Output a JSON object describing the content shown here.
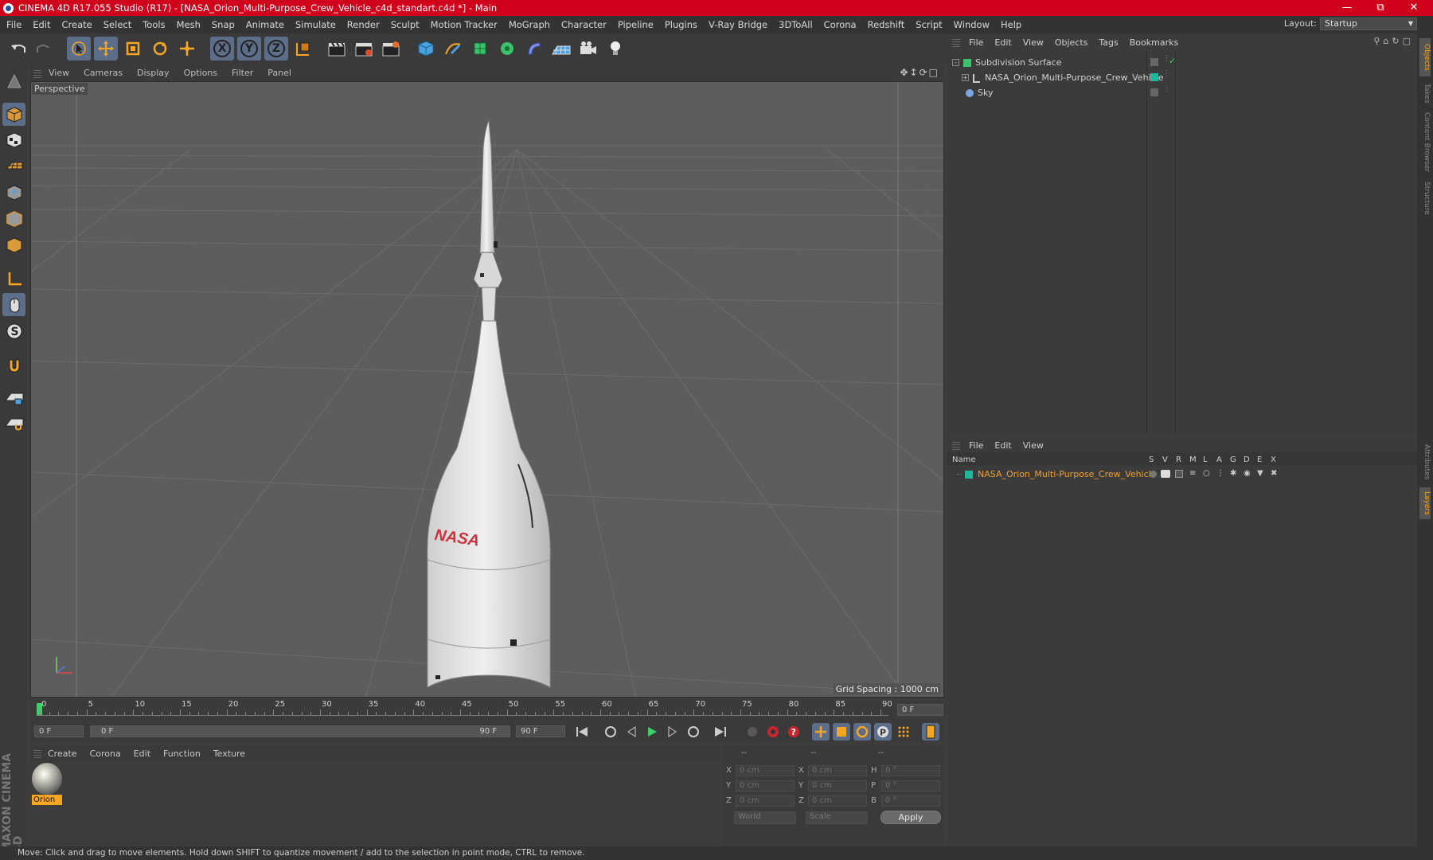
{
  "window": {
    "title": "CINEMA 4D R17.055 Studio (R17) - [NASA_Orion_Multi-Purpose_Crew_Vehicle_c4d_standart.c4d *] - Main"
  },
  "menubar": {
    "items": [
      "File",
      "Edit",
      "Create",
      "Select",
      "Tools",
      "Mesh",
      "Snap",
      "Animate",
      "Simulate",
      "Render",
      "Sculpt",
      "Motion Tracker",
      "MoGraph",
      "Character",
      "Pipeline",
      "Plugins",
      "V-Ray Bridge",
      "3DToAll",
      "Corona",
      "Redshift",
      "Script",
      "Window",
      "Help"
    ],
    "layout_label": "Layout:",
    "layout_value": "Startup"
  },
  "toolbar": {
    "axis_x": "X",
    "axis_y": "Y",
    "axis_z": "Z"
  },
  "viewport": {
    "menu": [
      "View",
      "Cameras",
      "Display",
      "Options",
      "Filter",
      "Panel"
    ],
    "camera_label": "Perspective",
    "grid_spacing": "Grid Spacing : 1000 cm",
    "model_logo": "NASA"
  },
  "timeline": {
    "ticks": [
      "0",
      "5",
      "10",
      "15",
      "20",
      "25",
      "30",
      "35",
      "40",
      "45",
      "50",
      "55",
      "60",
      "65",
      "70",
      "75",
      "80",
      "85",
      "90"
    ],
    "current_frame": "0 F"
  },
  "transport": {
    "start_frame": "0 F",
    "range_start": "0 F",
    "range_end": "90 F",
    "end_frame": "90 F"
  },
  "material_manager": {
    "menu": [
      "Create",
      "Corona",
      "Edit",
      "Function",
      "Texture"
    ],
    "materials": [
      {
        "name": "Orion"
      }
    ]
  },
  "coordinates": {
    "headers": [
      "--",
      "--",
      "--"
    ],
    "rows": [
      {
        "l1": "X",
        "v1": "0 cm",
        "l2": "X",
        "v2": "0 cm",
        "l3": "H",
        "v3": "0 °"
      },
      {
        "l1": "Y",
        "v1": "0 cm",
        "l2": "Y",
        "v2": "0 cm",
        "l3": "P",
        "v3": "0 °"
      },
      {
        "l1": "Z",
        "v1": "0 cm",
        "l2": "Z",
        "v2": "0 cm",
        "l3": "B",
        "v3": "0 °"
      }
    ],
    "mode_world": "World",
    "mode_scale": "Scale",
    "apply_label": "Apply"
  },
  "object_manager": {
    "menu": [
      "File",
      "Edit",
      "View",
      "Objects",
      "Tags",
      "Bookmarks"
    ],
    "objects": [
      {
        "name": "Subdivision Surface"
      },
      {
        "name": "NASA_Orion_Multi-Purpose_Crew_Vehicle"
      },
      {
        "name": "Sky"
      }
    ]
  },
  "layer_manager": {
    "menu": [
      "File",
      "Edit",
      "View"
    ],
    "name_header": "Name",
    "columns": [
      "S",
      "V",
      "R",
      "M",
      "L",
      "A",
      "G",
      "D",
      "E",
      "X"
    ],
    "layers": [
      {
        "name": "NASA_Orion_Multi-Purpose_Crew_Vehicle"
      }
    ]
  },
  "right_tabs": [
    "Objects",
    "Takes",
    "Content Browser",
    "Structure",
    "Attributes",
    "Layers"
  ],
  "brand": "MAXON CINEMA 4D",
  "status": "Move: Click and drag to move elements. Hold down SHIFT to quantize movement / add to the selection in point mode, CTRL to remove.",
  "colors": {
    "title_bar": "#d0021b",
    "accent": "#f5a623",
    "layer_text": "#f0a030",
    "layer_color": "#1fb89a"
  }
}
